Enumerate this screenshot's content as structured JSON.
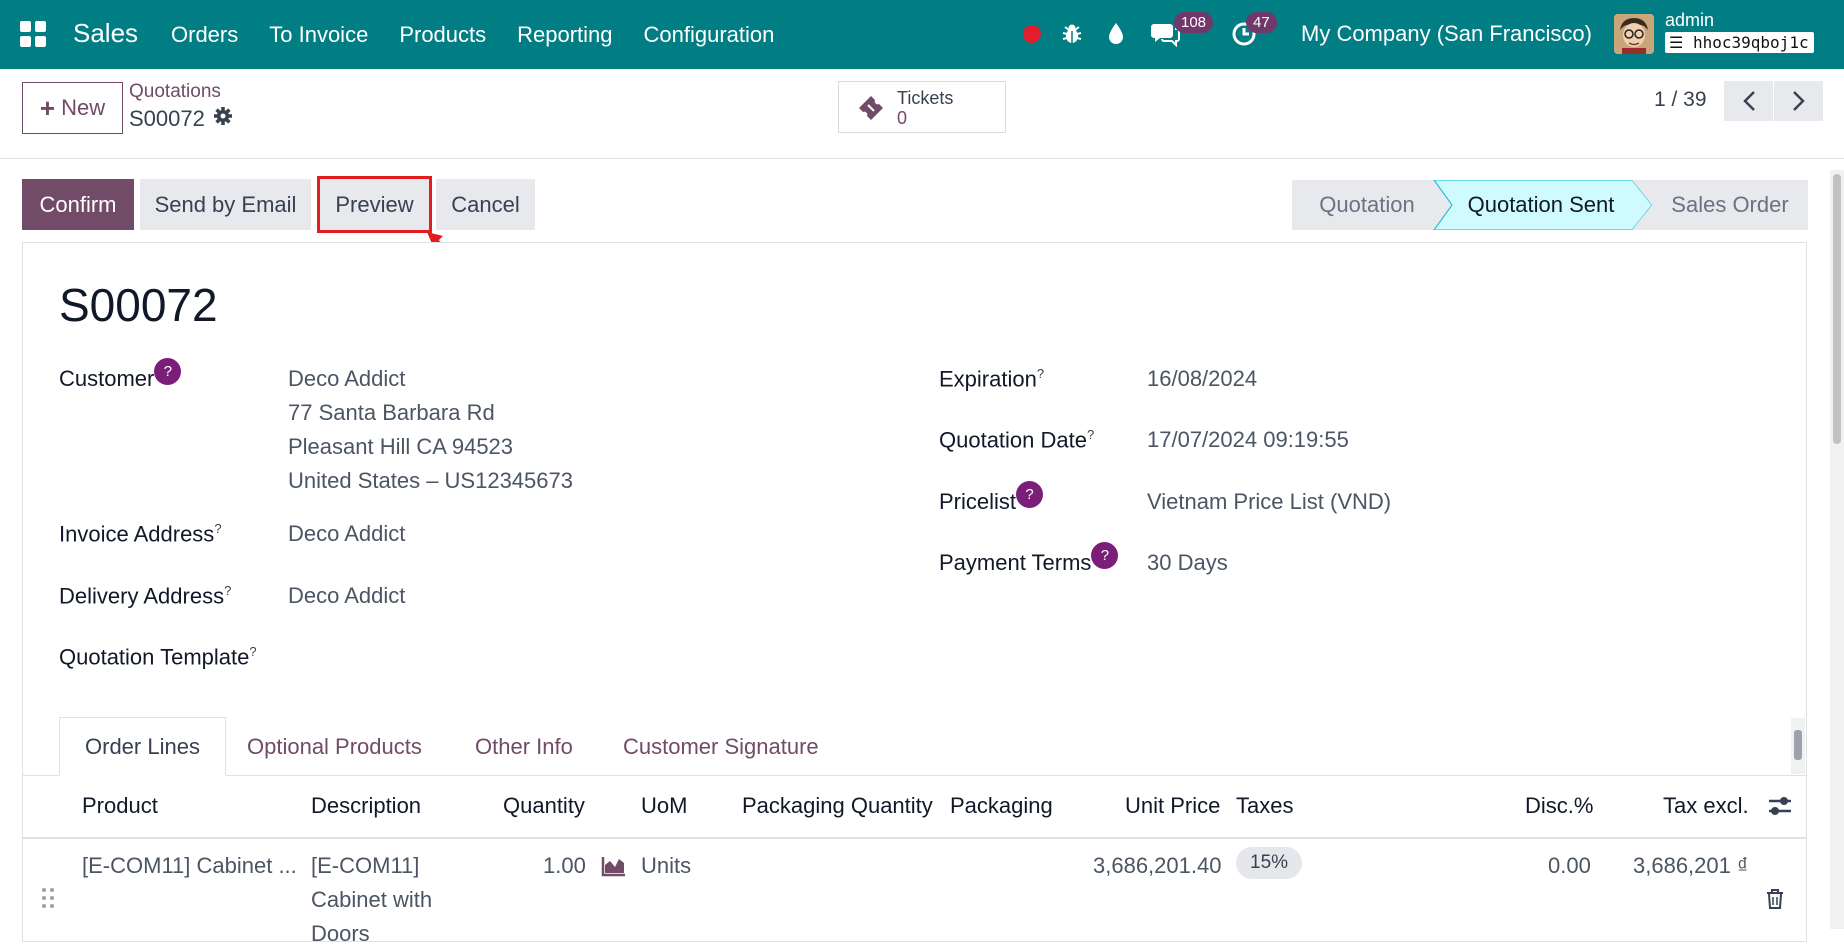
{
  "navbar": {
    "app_name": "Sales",
    "menu": [
      "Orders",
      "To Invoice",
      "Products",
      "Reporting",
      "Configuration"
    ],
    "messages_count": "108",
    "activities_count": "47",
    "company": "My Company (San Francisco)",
    "user": "admin",
    "database": "hhoc39qboj1c"
  },
  "control_panel": {
    "new_label": "New",
    "breadcrumb_parent": "Quotations",
    "breadcrumb_current": "S00072",
    "tickets_label": "Tickets",
    "tickets_count": "0",
    "pager": "1 / 39"
  },
  "actions": {
    "confirm": "Confirm",
    "send_by_email": "Send by Email",
    "preview": "Preview",
    "cancel": "Cancel"
  },
  "stages": [
    "Quotation",
    "Quotation Sent",
    "Sales Order"
  ],
  "active_stage": "Quotation Sent",
  "record": {
    "name": "S00072",
    "customer_label": "Customer",
    "customer_lines": [
      "Deco Addict",
      "77 Santa Barbara Rd",
      "Pleasant Hill CA 94523",
      "United States – US12345673"
    ],
    "invoice_address_label": "Invoice Address",
    "invoice_address": "Deco Addict",
    "delivery_address_label": "Delivery Address",
    "delivery_address": "Deco Addict",
    "quotation_template_label": "Quotation Template",
    "expiration_label": "Expiration",
    "expiration": "16/08/2024",
    "quotation_date_label": "Quotation Date",
    "quotation_date": "17/07/2024 09:19:55",
    "pricelist_label": "Pricelist",
    "pricelist": "Vietnam Price List (VND)",
    "payment_terms_label": "Payment Terms",
    "payment_terms": "30 Days",
    "help_mark": "?",
    "tooltip_mark": "?"
  },
  "tabs": [
    "Order Lines",
    "Optional Products",
    "Other Info",
    "Customer Signature"
  ],
  "table": {
    "headers": [
      "Product",
      "Description",
      "Quantity",
      "UoM",
      "Packaging Quantity",
      "Packaging",
      "Unit Price",
      "Taxes",
      "Disc.%",
      "Tax excl."
    ],
    "rows": [
      {
        "product": "[E-COM11] Cabinet ...",
        "description_1": "[E-COM11]",
        "description_2": "Cabinet with",
        "description_3": "Doors",
        "quantity": "1.00",
        "uom": "Units",
        "unit_price": "3,686,201.40",
        "taxes": "15%",
        "discount": "0.00",
        "tax_excl": "3,686,201 ₫"
      }
    ]
  },
  "colors": {
    "navbar": "#017e84",
    "primary": "#714b67",
    "active_stage": "#cffafe",
    "highlight": "#e11d1d"
  }
}
